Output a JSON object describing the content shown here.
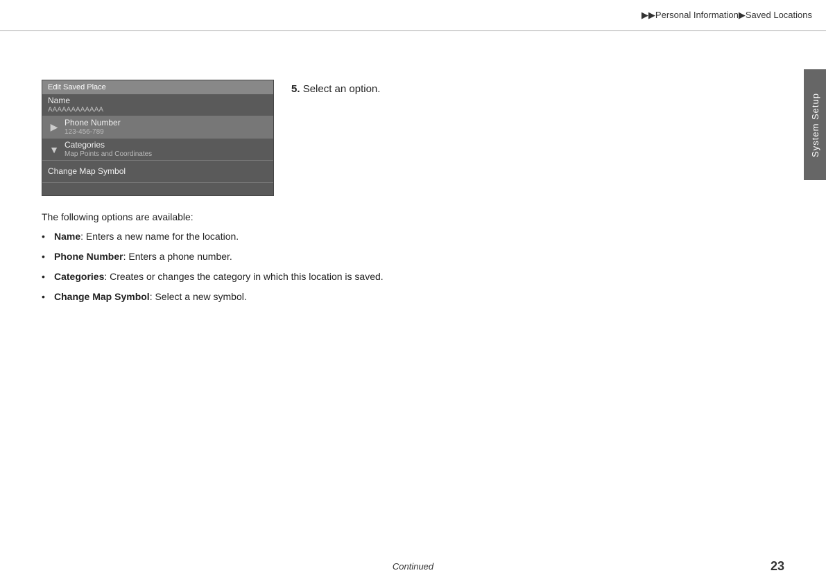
{
  "breadcrumb": {
    "arrow1": "▶▶",
    "part1": "Personal Information",
    "arrow2": "▶",
    "part2": "Saved Locations"
  },
  "sidebar": {
    "label": "System Setup"
  },
  "device": {
    "header": "Edit Saved Place",
    "items": [
      {
        "id": "name",
        "main": "Name",
        "sub": "AAAAAAAAAAAA",
        "icon": "",
        "selected": false,
        "has_icon": false
      },
      {
        "id": "phone",
        "main": "Phone Number",
        "sub": "123-456-789",
        "icon": "▶",
        "selected": true,
        "has_icon": true
      },
      {
        "id": "categories",
        "main": "Categories",
        "sub": "Map Points and Coordinates",
        "icon": "▼",
        "selected": false,
        "has_icon": true
      },
      {
        "id": "change-map",
        "main": "Change Map Symbol",
        "sub": "",
        "icon": "",
        "selected": false,
        "has_icon": false
      }
    ]
  },
  "step": {
    "number": "5.",
    "text": "Select an option."
  },
  "options": {
    "intro": "The following options are available:",
    "items": [
      {
        "bold": "Name",
        "description": ": Enters a new name for the location."
      },
      {
        "bold": "Phone Number",
        "description": ": Enters a phone number."
      },
      {
        "bold": "Categories",
        "description": ": Creates or changes the category in which this location is saved."
      },
      {
        "bold": "Change Map Symbol",
        "description": ": Select a new symbol."
      }
    ]
  },
  "footer": {
    "continued": "Continued",
    "page": "23"
  }
}
